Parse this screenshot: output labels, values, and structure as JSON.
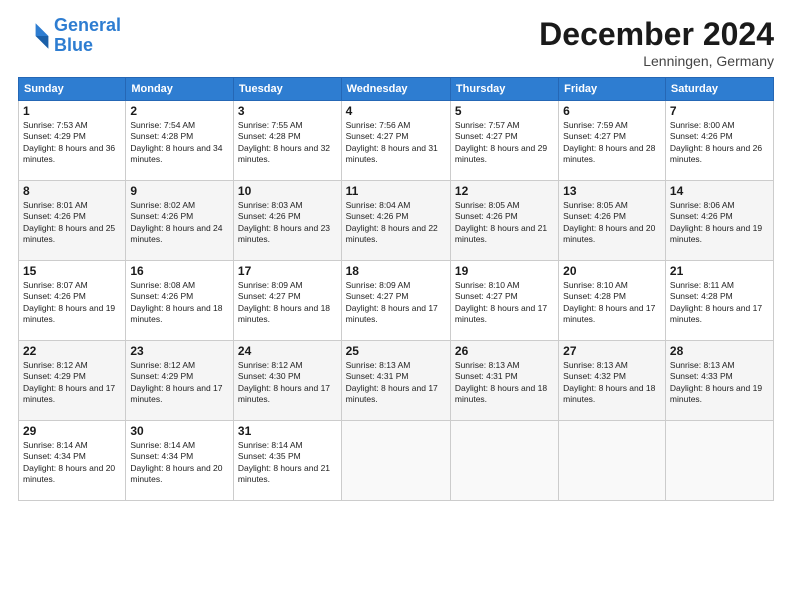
{
  "header": {
    "logo_line1": "General",
    "logo_line2": "Blue",
    "month_title": "December 2024",
    "location": "Lenningen, Germany"
  },
  "days_of_week": [
    "Sunday",
    "Monday",
    "Tuesday",
    "Wednesday",
    "Thursday",
    "Friday",
    "Saturday"
  ],
  "weeks": [
    [
      {
        "num": "1",
        "rise": "7:53 AM",
        "set": "4:29 PM",
        "daylight": "8 hours and 36 minutes."
      },
      {
        "num": "2",
        "rise": "7:54 AM",
        "set": "4:28 PM",
        "daylight": "8 hours and 34 minutes."
      },
      {
        "num": "3",
        "rise": "7:55 AM",
        "set": "4:28 PM",
        "daylight": "8 hours and 32 minutes."
      },
      {
        "num": "4",
        "rise": "7:56 AM",
        "set": "4:27 PM",
        "daylight": "8 hours and 31 minutes."
      },
      {
        "num": "5",
        "rise": "7:57 AM",
        "set": "4:27 PM",
        "daylight": "8 hours and 29 minutes."
      },
      {
        "num": "6",
        "rise": "7:59 AM",
        "set": "4:27 PM",
        "daylight": "8 hours and 28 minutes."
      },
      {
        "num": "7",
        "rise": "8:00 AM",
        "set": "4:26 PM",
        "daylight": "8 hours and 26 minutes."
      }
    ],
    [
      {
        "num": "8",
        "rise": "8:01 AM",
        "set": "4:26 PM",
        "daylight": "8 hours and 25 minutes."
      },
      {
        "num": "9",
        "rise": "8:02 AM",
        "set": "4:26 PM",
        "daylight": "8 hours and 24 minutes."
      },
      {
        "num": "10",
        "rise": "8:03 AM",
        "set": "4:26 PM",
        "daylight": "8 hours and 23 minutes."
      },
      {
        "num": "11",
        "rise": "8:04 AM",
        "set": "4:26 PM",
        "daylight": "8 hours and 22 minutes."
      },
      {
        "num": "12",
        "rise": "8:05 AM",
        "set": "4:26 PM",
        "daylight": "8 hours and 21 minutes."
      },
      {
        "num": "13",
        "rise": "8:05 AM",
        "set": "4:26 PM",
        "daylight": "8 hours and 20 minutes."
      },
      {
        "num": "14",
        "rise": "8:06 AM",
        "set": "4:26 PM",
        "daylight": "8 hours and 19 minutes."
      }
    ],
    [
      {
        "num": "15",
        "rise": "8:07 AM",
        "set": "4:26 PM",
        "daylight": "8 hours and 19 minutes."
      },
      {
        "num": "16",
        "rise": "8:08 AM",
        "set": "4:26 PM",
        "daylight": "8 hours and 18 minutes."
      },
      {
        "num": "17",
        "rise": "8:09 AM",
        "set": "4:27 PM",
        "daylight": "8 hours and 18 minutes."
      },
      {
        "num": "18",
        "rise": "8:09 AM",
        "set": "4:27 PM",
        "daylight": "8 hours and 17 minutes."
      },
      {
        "num": "19",
        "rise": "8:10 AM",
        "set": "4:27 PM",
        "daylight": "8 hours and 17 minutes."
      },
      {
        "num": "20",
        "rise": "8:10 AM",
        "set": "4:28 PM",
        "daylight": "8 hours and 17 minutes."
      },
      {
        "num": "21",
        "rise": "8:11 AM",
        "set": "4:28 PM",
        "daylight": "8 hours and 17 minutes."
      }
    ],
    [
      {
        "num": "22",
        "rise": "8:12 AM",
        "set": "4:29 PM",
        "daylight": "8 hours and 17 minutes."
      },
      {
        "num": "23",
        "rise": "8:12 AM",
        "set": "4:29 PM",
        "daylight": "8 hours and 17 minutes."
      },
      {
        "num": "24",
        "rise": "8:12 AM",
        "set": "4:30 PM",
        "daylight": "8 hours and 17 minutes."
      },
      {
        "num": "25",
        "rise": "8:13 AM",
        "set": "4:31 PM",
        "daylight": "8 hours and 17 minutes."
      },
      {
        "num": "26",
        "rise": "8:13 AM",
        "set": "4:31 PM",
        "daylight": "8 hours and 18 minutes."
      },
      {
        "num": "27",
        "rise": "8:13 AM",
        "set": "4:32 PM",
        "daylight": "8 hours and 18 minutes."
      },
      {
        "num": "28",
        "rise": "8:13 AM",
        "set": "4:33 PM",
        "daylight": "8 hours and 19 minutes."
      }
    ],
    [
      {
        "num": "29",
        "rise": "8:14 AM",
        "set": "4:34 PM",
        "daylight": "8 hours and 20 minutes."
      },
      {
        "num": "30",
        "rise": "8:14 AM",
        "set": "4:34 PM",
        "daylight": "8 hours and 20 minutes."
      },
      {
        "num": "31",
        "rise": "8:14 AM",
        "set": "4:35 PM",
        "daylight": "8 hours and 21 minutes."
      },
      null,
      null,
      null,
      null
    ]
  ]
}
